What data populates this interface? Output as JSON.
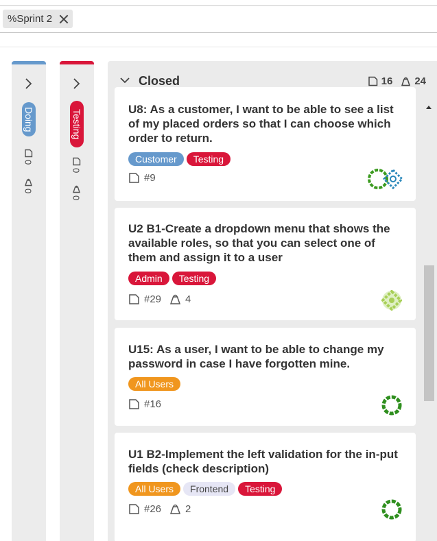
{
  "filter": {
    "label": "%Sprint 2"
  },
  "columns": {
    "doing": {
      "label": "Doing",
      "color": "#6699cc",
      "items_count": "0",
      "points": "0"
    },
    "testing": {
      "label": "Testing",
      "color": "#d9163a",
      "items_count": "0",
      "points": "0"
    },
    "closed": {
      "title": "Closed",
      "items_count": "16",
      "points": "24"
    }
  },
  "tag_colors": {
    "Customer": "#6699cc",
    "Testing": "#d9163a",
    "Admin": "#d9163a",
    "All Users": "#f0961e",
    "Frontend": "#e6e6f5"
  },
  "cards": [
    {
      "title": "U8: As a customer, I want to be able to see a list of my placed orders so that I can choose which order to return.",
      "tags": [
        "Customer",
        "Testing"
      ],
      "id": "#9",
      "points": ""
    },
    {
      "title": "U2 B1-Create a dropdown menu that shows the available roles, so that you can select one of them and assign it to a user",
      "tags": [
        "Admin",
        "Testing"
      ],
      "id": "#29",
      "points": "4"
    },
    {
      "title": "U15: As a user, I want to be able to change my password in case I have forgotten mine.",
      "tags": [
        "All Users"
      ],
      "id": "#16",
      "points": ""
    },
    {
      "title": "U1 B2-Implement the left validation for the in-put fields (check description)",
      "tags": [
        "All Users",
        "Frontend",
        "Testing"
      ],
      "id": "#26",
      "points": "2"
    }
  ]
}
